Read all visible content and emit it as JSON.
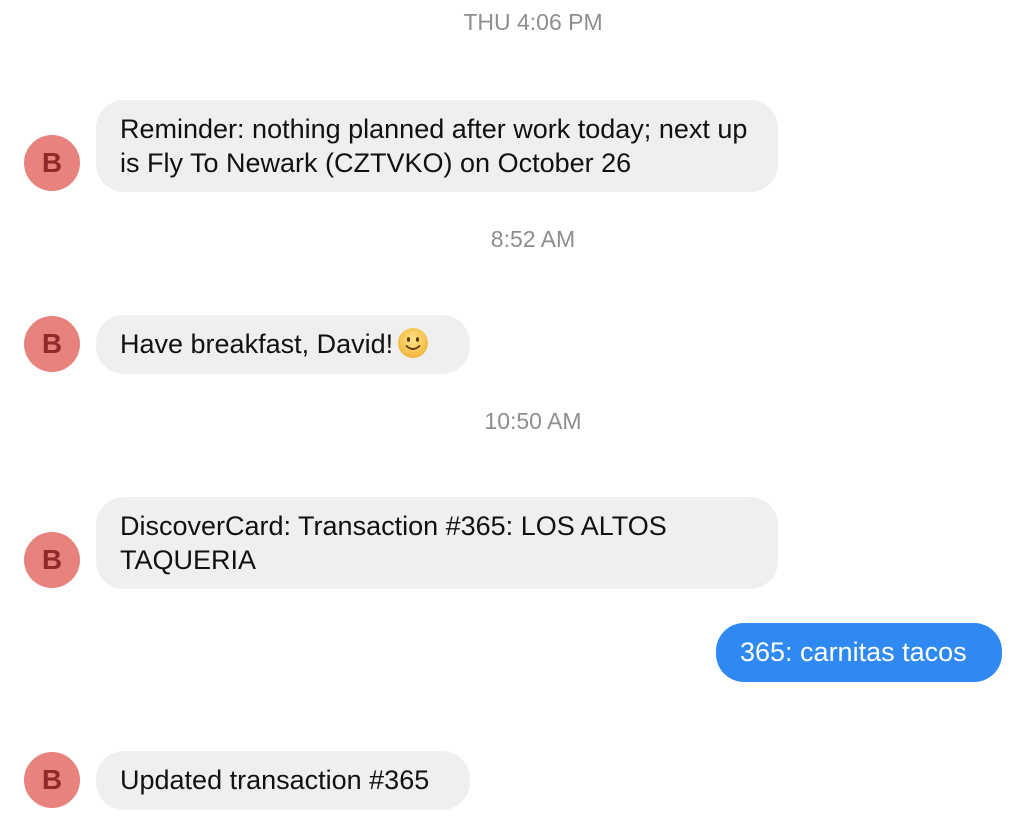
{
  "timestamps": [
    "THU 4:06 PM",
    "8:52 AM",
    "10:50 AM"
  ],
  "sender_initial": "B",
  "messages": [
    {
      "direction": "incoming",
      "text": "Reminder: nothing planned after work today; next up is Fly To Newark (CZTVKO) on October 26"
    },
    {
      "direction": "incoming",
      "text": "Have breakfast, David!",
      "emoji": "slightly-smiling-face"
    },
    {
      "direction": "incoming",
      "text": "DiscoverCard: Transaction #365: LOS ALTOS TAQUERIA"
    },
    {
      "direction": "outgoing",
      "text": "365: carnitas tacos"
    },
    {
      "direction": "incoming",
      "text": "Updated transaction #365"
    }
  ],
  "colors": {
    "avatar_bg": "#e8827c",
    "avatar_text": "#8e2a2a",
    "incoming_bubble": "#efefef",
    "outgoing_bubble": "#2f89f3",
    "timestamp_text": "#8e8e8e"
  }
}
